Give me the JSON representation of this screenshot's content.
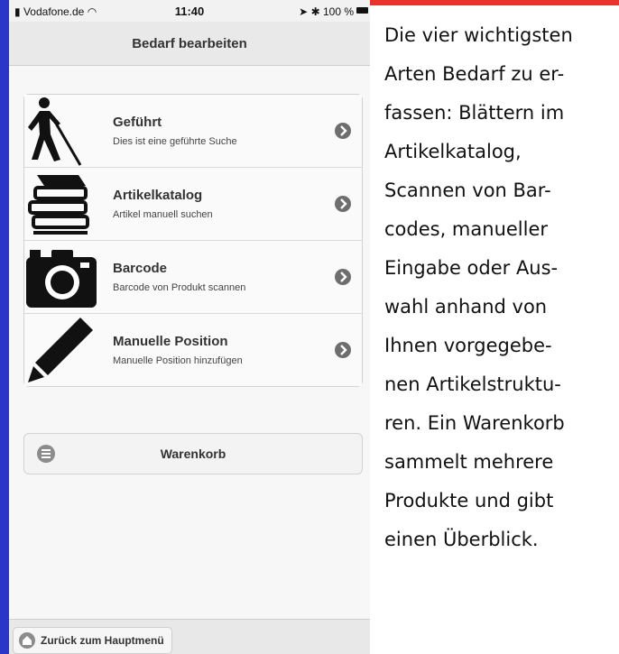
{
  "status_bar": {
    "carrier": "Vodafone.de",
    "time": "11:40",
    "battery": "100 %"
  },
  "nav": {
    "title": "Bedarf bearbeiten"
  },
  "menu": [
    {
      "title": "Geführt",
      "subtitle": "Dies ist eine geführte Suche",
      "icon": "blind-person-icon"
    },
    {
      "title": "Artikelkatalog",
      "subtitle": "Artikel manuell suchen",
      "icon": "books-icon"
    },
    {
      "title": "Barcode",
      "subtitle": "Barcode von Produkt scannen",
      "icon": "camera-icon"
    },
    {
      "title": "Manuelle Position",
      "subtitle": "Manuelle Position hinzufügen",
      "icon": "pencil-icon"
    }
  ],
  "cart": {
    "label": "Warenkorb",
    "icon": "list-icon"
  },
  "footer": {
    "back_label": "Zurück zum Hauptmenü",
    "icon": "home-icon"
  },
  "caption": {
    "lines": [
      "Die vier wichtigsten",
      "Arten Bedarf zu er-",
      "fassen: Blättern im",
      "Artikelkatalog,",
      "Scannen von Bar-",
      "codes, manueller",
      "Eingabe oder Aus-",
      "wahl anhand von",
      "Ihnen vorgegebe-",
      "nen Artikelstruktu-",
      "ren. Ein Warenkorb",
      "sammelt mehrere",
      "Produkte und gibt",
      "einen Überblick."
    ]
  },
  "colors": {
    "top_accent": "#e8332a",
    "left_accent": "#2a36c8"
  }
}
